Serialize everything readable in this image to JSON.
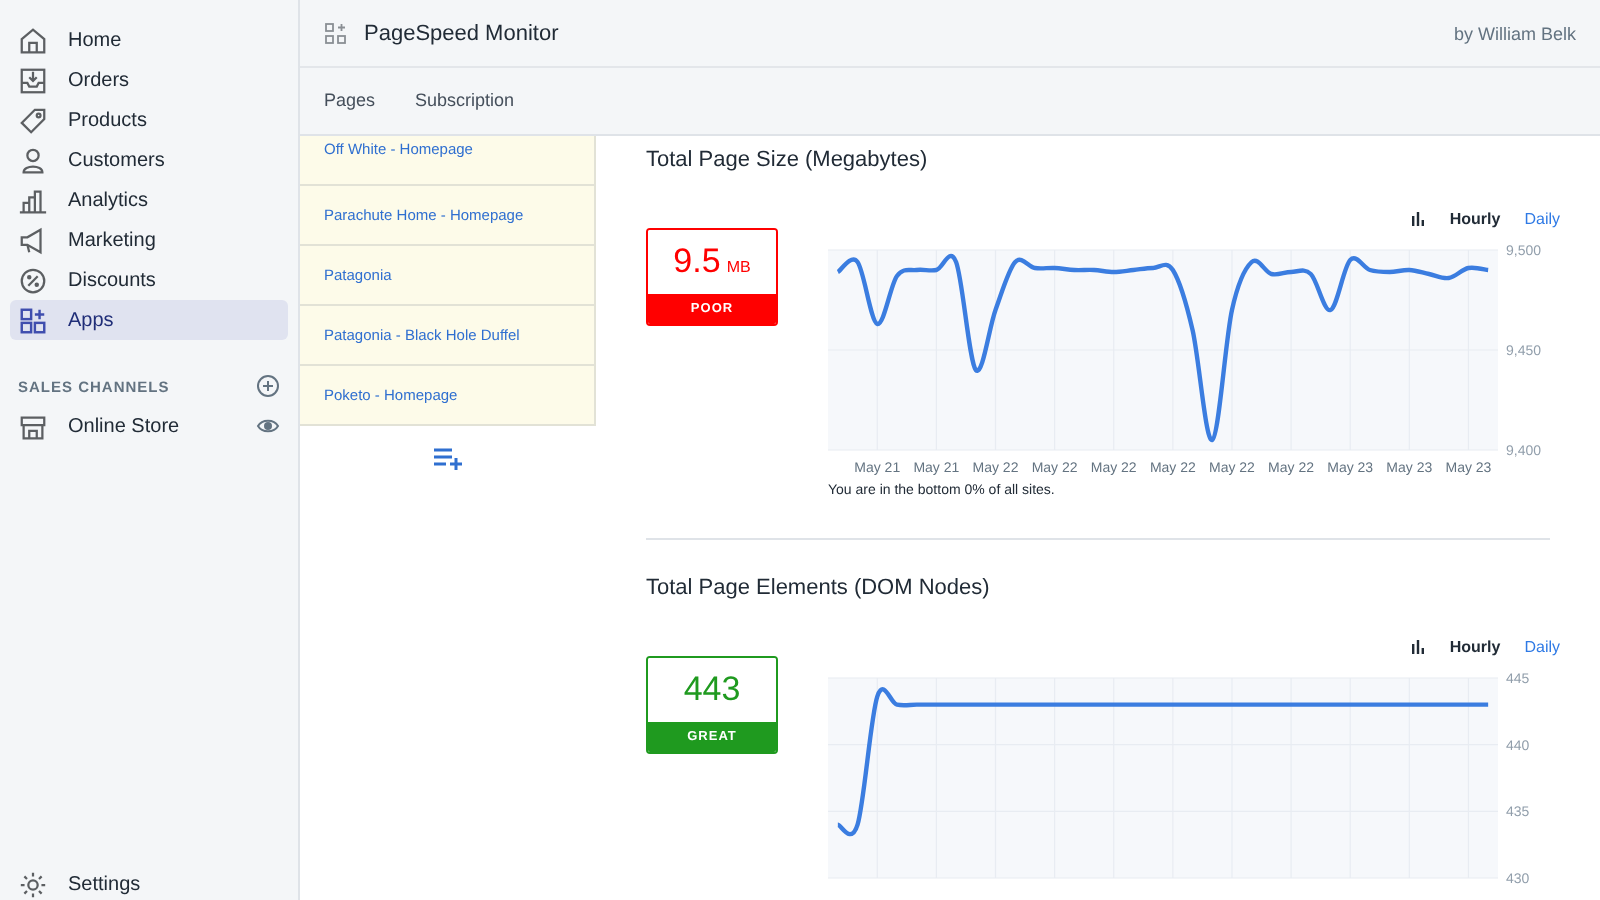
{
  "sidebar": {
    "items": [
      {
        "label": "Home",
        "selected": false
      },
      {
        "label": "Orders",
        "selected": false
      },
      {
        "label": "Products",
        "selected": false
      },
      {
        "label": "Customers",
        "selected": false
      },
      {
        "label": "Analytics",
        "selected": false
      },
      {
        "label": "Marketing",
        "selected": false
      },
      {
        "label": "Discounts",
        "selected": false
      },
      {
        "label": "Apps",
        "selected": true
      }
    ],
    "section_title": "SALES CHANNELS",
    "channels": [
      {
        "label": "Online Store"
      }
    ],
    "settings": "Settings"
  },
  "header": {
    "title": "PageSpeed Monitor",
    "author": "by William Belk"
  },
  "tabs": [
    {
      "label": "Pages",
      "selected": false
    },
    {
      "label": "Subscription",
      "selected": false
    }
  ],
  "pages": [
    "Off White - Homepage",
    "Parachute Home - Homepage",
    "Patagonia",
    "Patagonia - Black Hole Duffel",
    "Poketo - Homepage"
  ],
  "metrics": [
    {
      "title": "Total Page Size (Megabytes)",
      "value": "9.5",
      "unit": "MB",
      "rating": "POOR",
      "color": "#ff0000",
      "options": [
        {
          "label": "Hourly",
          "selected": true
        },
        {
          "label": "Daily",
          "selected": false
        }
      ],
      "footnote": "You are in the bottom 0% of all sites.",
      "chart_data": {
        "type": "line",
        "grid": true,
        "categories": [
          null,
          null,
          "May 21",
          null,
          null,
          "May 21",
          null,
          null,
          "May 22",
          null,
          null,
          "May 22",
          null,
          null,
          "May 22",
          null,
          null,
          "May 22",
          null,
          null,
          "May 22",
          null,
          null,
          "May 22",
          null,
          null,
          "May 23",
          null,
          null,
          "May 23",
          null,
          null,
          "May 23",
          null
        ],
        "series": [
          {
            "color": "#3b7de0",
            "values": [
              9489,
              9494,
              9463,
              9487,
              9490,
              9490,
              9494,
              9440,
              9470,
              9494,
              9491,
              9491,
              9490,
              9490,
              9489,
              9490,
              9491,
              9490,
              9460,
              9405,
              9470,
              9494,
              9488,
              9489,
              9488,
              9470,
              9495,
              9490,
              9489,
              9490,
              9488,
              9486,
              9491,
              9490
            ]
          }
        ],
        "ylim": [
          9400,
          9500
        ],
        "yticks": [
          {
            "value": 9400,
            "label": "9,400"
          },
          {
            "value": 9450,
            "label": "9,450"
          },
          {
            "value": 9500,
            "label": "9,500"
          }
        ]
      }
    },
    {
      "title": "Total Page Elements (DOM Nodes)",
      "value": "443",
      "rating": "GREAT",
      "color": "#1f9a1f",
      "options": [
        {
          "label": "Hourly",
          "selected": true
        },
        {
          "label": "Daily",
          "selected": false
        }
      ],
      "chart_data": {
        "type": "line",
        "grid": true,
        "categories": [
          null,
          null,
          null,
          null,
          null,
          null,
          null,
          null,
          null,
          null,
          null,
          null,
          null,
          null,
          null,
          null,
          null,
          null,
          null,
          null,
          null,
          null,
          null,
          null,
          null,
          null,
          null,
          null,
          null,
          null,
          null,
          null,
          null,
          null
        ],
        "series": [
          {
            "color": "#3b7de0",
            "values": [
              434,
              434,
              443.6,
              443,
              443,
              443,
              443,
              443,
              443,
              443,
              443,
              443,
              443,
              443,
              443,
              443,
              443,
              443,
              443,
              443,
              443,
              443,
              443,
              443,
              443,
              443,
              443,
              443,
              443,
              443,
              443,
              443,
              443,
              443
            ]
          }
        ],
        "ylim": [
          430,
          445
        ],
        "yticks": [
          430,
          435,
          440,
          445
        ]
      }
    }
  ]
}
